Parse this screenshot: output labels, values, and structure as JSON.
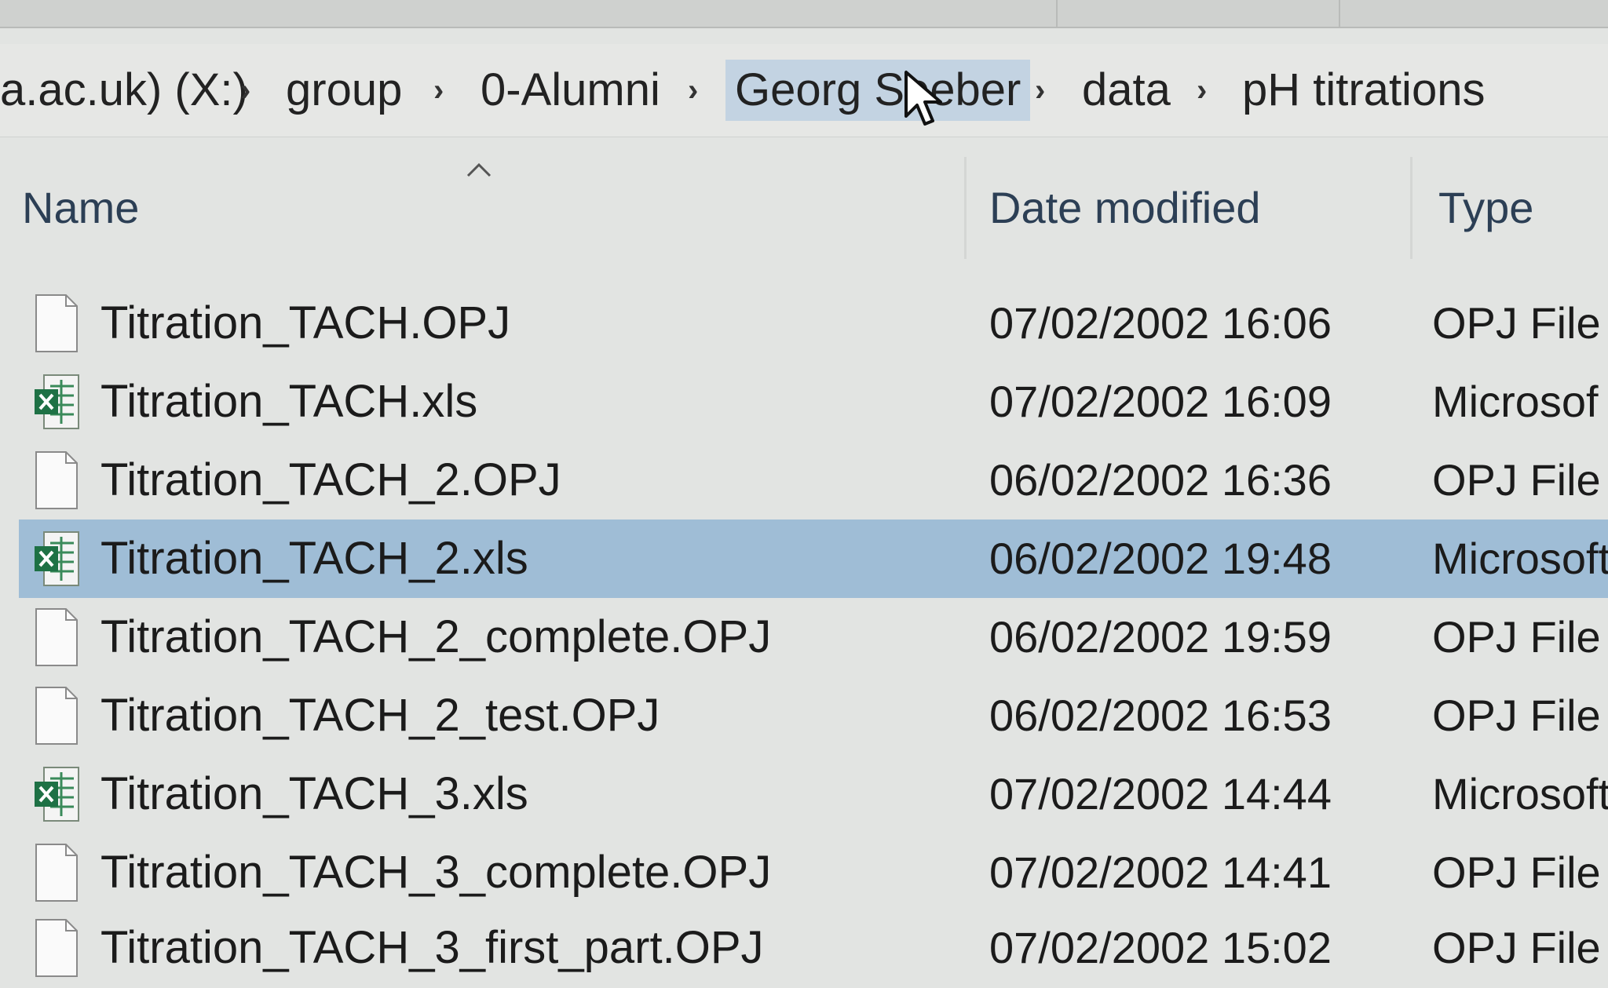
{
  "address_bar": {
    "crumbs": [
      "a.ac.uk) (X:)",
      "group",
      "0-Alumni",
      "Georg Seeber",
      "data",
      "pH titrations"
    ]
  },
  "columns": {
    "name": "Name",
    "date": "Date modified",
    "type": "Type"
  },
  "files": [
    {
      "name": "Titration_TACH.OPJ",
      "date": "07/02/2002 16:06",
      "type": "OPJ File",
      "icon": "opj-file-icon"
    },
    {
      "name": "Titration_TACH.xls",
      "date": "07/02/2002 16:09",
      "type": "Microsof",
      "icon": "excel-file-icon"
    },
    {
      "name": "Titration_TACH_2.OPJ",
      "date": "06/02/2002 16:36",
      "type": "OPJ File",
      "icon": "opj-file-icon"
    },
    {
      "name": "Titration_TACH_2.xls",
      "date": "06/02/2002 19:48",
      "type": "Microsoft",
      "icon": "excel-file-icon",
      "selected": true
    },
    {
      "name": "Titration_TACH_2_complete.OPJ",
      "date": "06/02/2002 19:59",
      "type": "OPJ File",
      "icon": "opj-file-icon"
    },
    {
      "name": "Titration_TACH_2_test.OPJ",
      "date": "06/02/2002 16:53",
      "type": "OPJ File",
      "icon": "opj-file-icon"
    },
    {
      "name": "Titration_TACH_3.xls",
      "date": "07/02/2002 14:44",
      "type": "Microsoft",
      "icon": "excel-file-icon"
    },
    {
      "name": "Titration_TACH_3_complete.OPJ",
      "date": "07/02/2002 14:41",
      "type": "OPJ File",
      "icon": "opj-file-icon"
    },
    {
      "name": "Titration_TACH_3_first_part.OPJ",
      "date": "07/02/2002 15:02",
      "type": "OPJ File",
      "icon": "opj-file-icon"
    }
  ],
  "colors": {
    "selection": "#9fbdd6",
    "breadcrumb_highlight": "#c3d3e2",
    "background": "#e2e4e2",
    "excel_green": "#1e7145"
  }
}
